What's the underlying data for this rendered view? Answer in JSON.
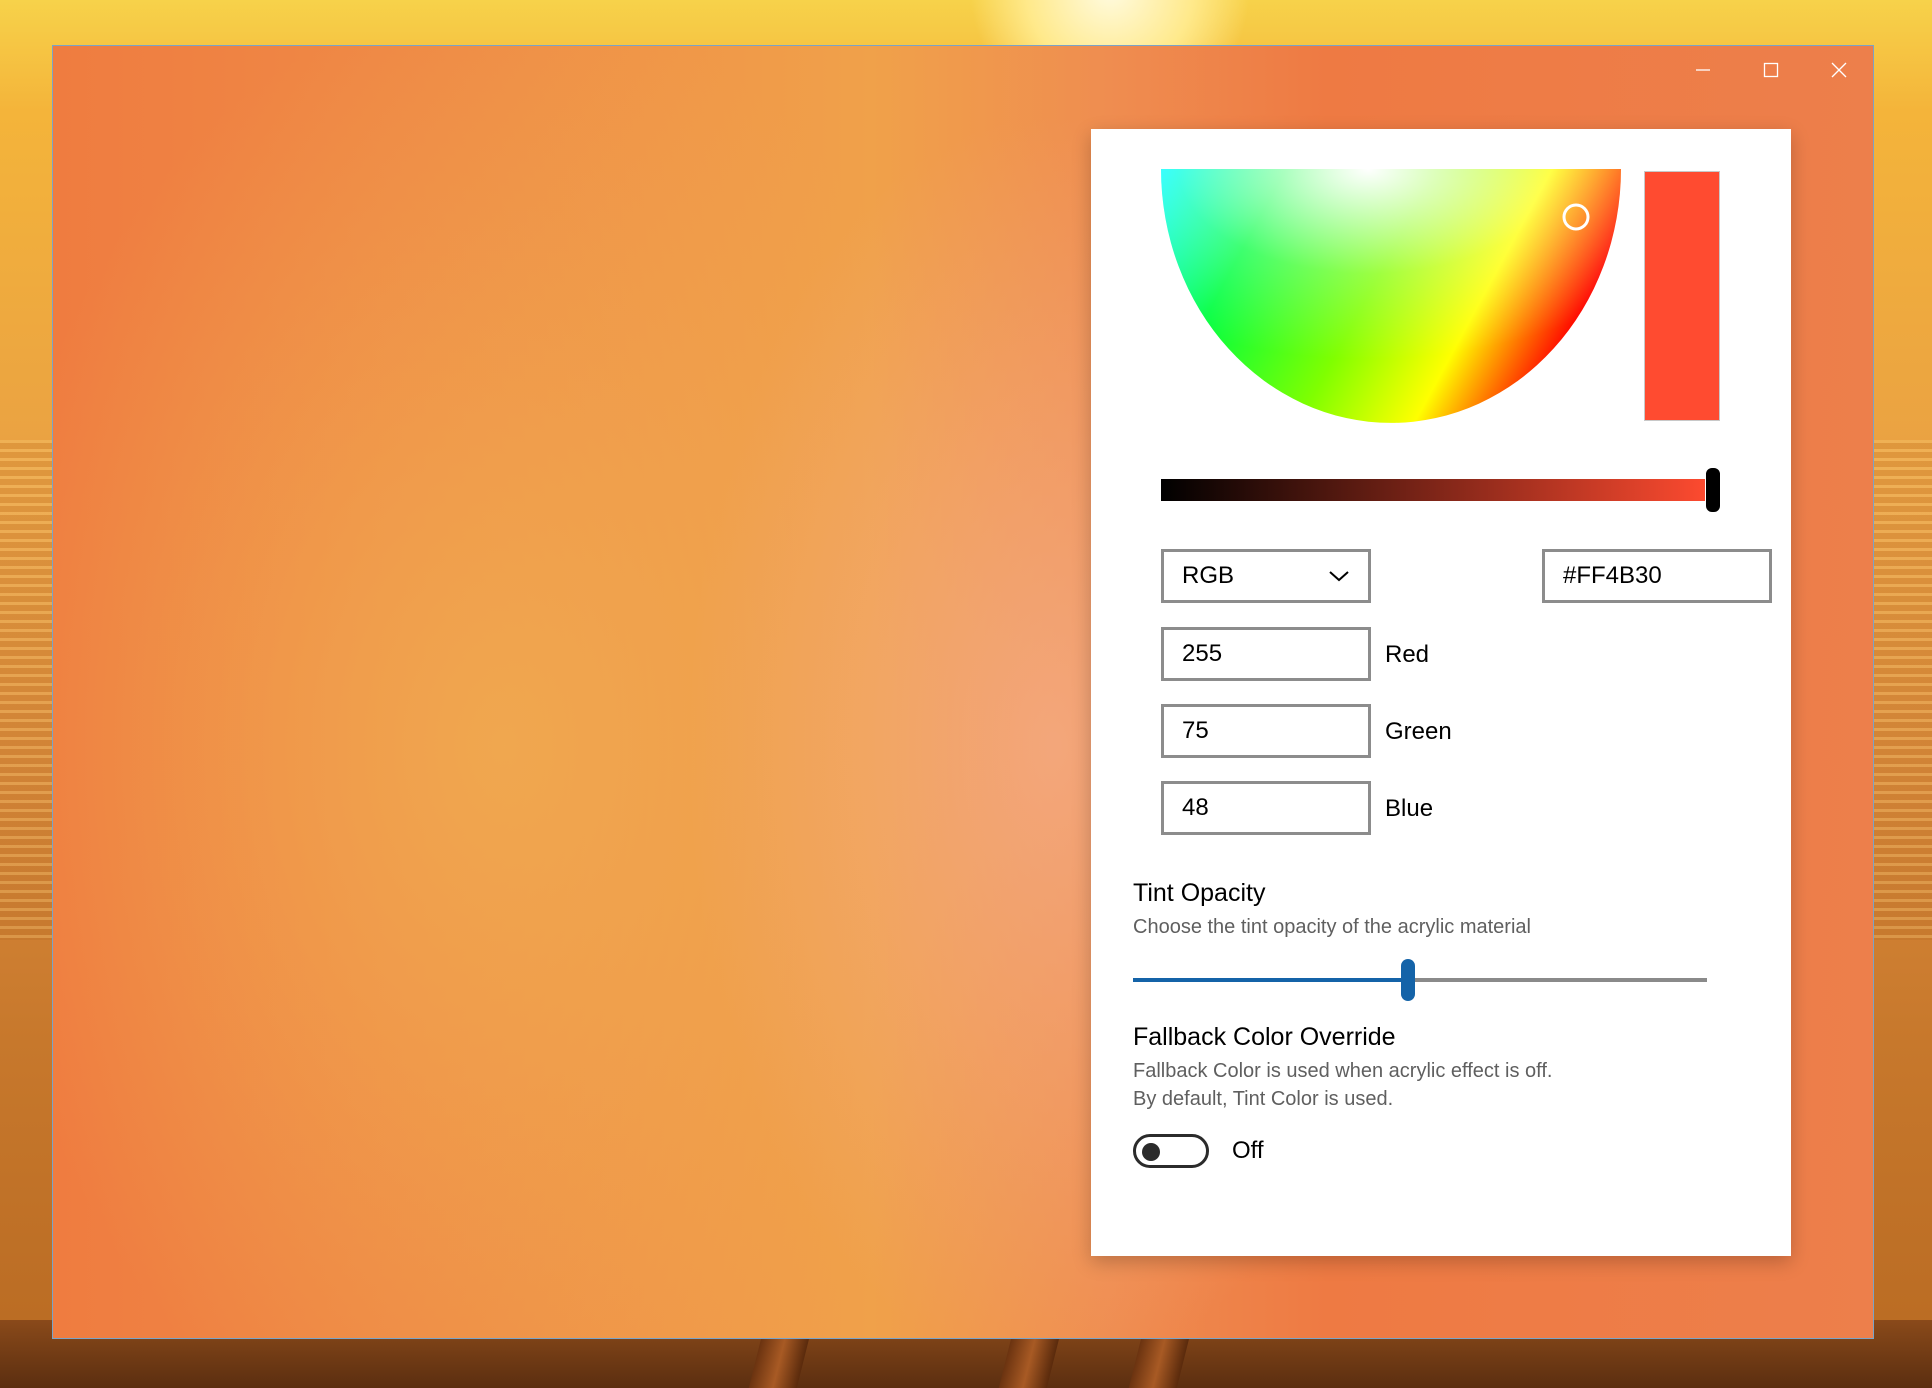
{
  "window": {
    "caption": {
      "minimize": "minimize-icon",
      "maximize": "maximize-icon",
      "close": "close-icon"
    }
  },
  "color_picker": {
    "selected_color": "#FF4B30",
    "mode_select": {
      "value": "RGB",
      "icon": "chevron-down-icon"
    },
    "hex_value": "#FF4B30",
    "channels": [
      {
        "value": "255",
        "label": "Red"
      },
      {
        "value": "75",
        "label": "Green"
      },
      {
        "value": "48",
        "label": "Blue"
      }
    ],
    "value_slider_level": 1.0
  },
  "tint_opacity": {
    "title": "Tint Opacity",
    "description": "Choose the tint opacity of the acrylic material",
    "value_fraction": 0.45,
    "accent": "#1463A8"
  },
  "fallback": {
    "title": "Fallback Color Override",
    "description_line1": "Fallback Color is used when acrylic effect is off.",
    "description_line2": "By default, Tint Color is used.",
    "toggle_state": "Off"
  }
}
